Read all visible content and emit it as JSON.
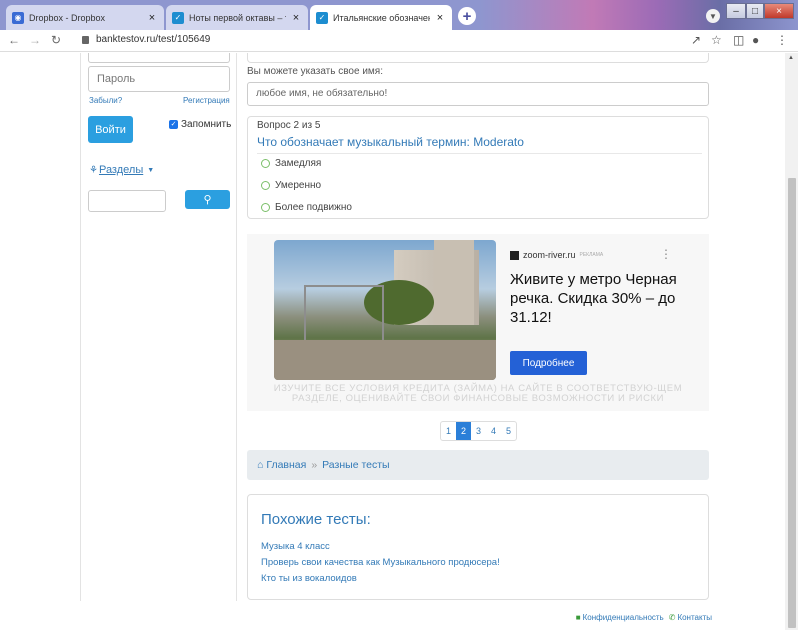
{
  "tabs": [
    {
      "title": "Dropbox - Dropbox",
      "icon": "dropbox-icon"
    },
    {
      "title": "Ноты первой октавы – тест на Б",
      "icon": "site-favicon-icon"
    },
    {
      "title": "Итальянские обозначения терм",
      "icon": "site-favicon-icon"
    }
  ],
  "address": {
    "url": "banktestov.ru/test/105649"
  },
  "login": {
    "password_placeholder": "Пароль",
    "forgot": "Забыли?",
    "register": "Регистрация",
    "login_button": "Войти",
    "remember": "Запомнить"
  },
  "sidebar": {
    "sections_label": "Разделы"
  },
  "name_block": {
    "hint": "Вы можете указать свое имя:",
    "placeholder": "любое имя, не обязательно!"
  },
  "quiz": {
    "counter": "Вопрос 2 из 5",
    "question": "Что обозначает музыкальный термин: Moderato",
    "options": [
      "Замедляя",
      "Умеренно",
      "Более подвижно"
    ]
  },
  "ad": {
    "source": "zoom-river.ru",
    "source_tag": "РЕКЛАМА",
    "headline": "Живите у метро Черная речка. Скидка 30% – до 31.12!",
    "button": "Подробнее",
    "disclaimer": "ИЗУЧИТЕ ВСЕ УСЛОВИЯ КРЕДИТА (ЗАЙМА) НА САЙТЕ В СООТВЕТСТВУЮ-ЩЕМ РАЗДЕЛЕ, ОЦЕНИВАЙТЕ СВОИ ФИНАНСОВЫЕ ВОЗМОЖНОСТИ И РИСКИ"
  },
  "pagination": {
    "pages": [
      "1",
      "2",
      "3",
      "4",
      "5"
    ],
    "current": "2"
  },
  "breadcrumb": {
    "home": "Главная",
    "current": "Разные тесты"
  },
  "similar": {
    "title": "Похожие тесты:",
    "links": [
      "Музыка 4 класс",
      "Проверь свои качества как Музыкального продюсера!",
      "Кто ты из вокалоидов"
    ]
  },
  "footer": {
    "privacy": "Конфиденциальность",
    "contacts": "Контакты"
  }
}
